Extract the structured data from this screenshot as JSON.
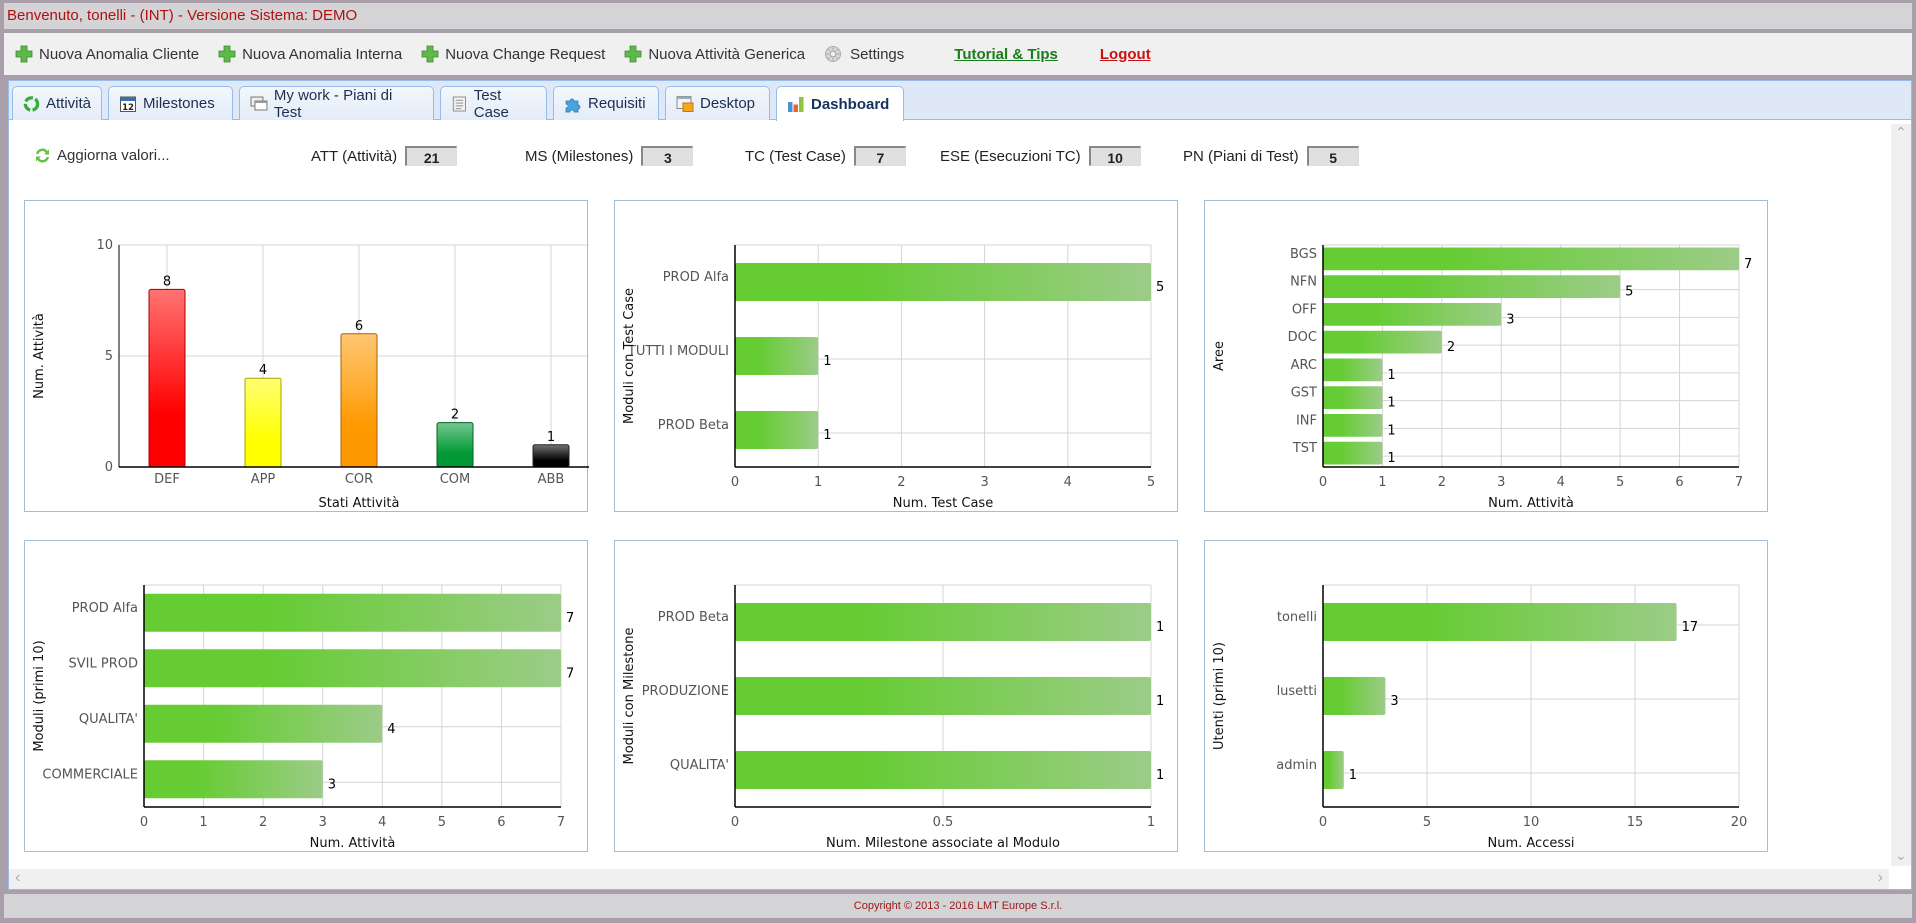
{
  "topbar": {
    "welcome": "Benvenuto, tonelli - (INT) - Versione Sistema: DEMO"
  },
  "toolbar": {
    "items": [
      {
        "label": "Nuova Anomalia Cliente",
        "icon": "plus-icon"
      },
      {
        "label": "Nuova Anomalia Interna",
        "icon": "plus-icon"
      },
      {
        "label": "Nuova Change Request",
        "icon": "plus-icon"
      },
      {
        "label": "Nuova Attività Generica",
        "icon": "plus-icon"
      },
      {
        "label": "Settings",
        "icon": "gear-icon"
      }
    ],
    "tutorial": "Tutorial & Tips",
    "logout": "Logout"
  },
  "tabs": [
    {
      "label": "Attività",
      "icon": "recycle-icon"
    },
    {
      "label": "Milestones",
      "icon": "calendar-icon"
    },
    {
      "label": "My work - Piani di Test",
      "icon": "windows-icon"
    },
    {
      "label": "Test Case",
      "icon": "list-document-icon"
    },
    {
      "label": "Requisiti",
      "icon": "puzzle-icon"
    },
    {
      "label": "Desktop",
      "icon": "desktop-folder-icon"
    },
    {
      "label": "Dashboard",
      "icon": "bar-chart-icon",
      "active": true
    }
  ],
  "stats": {
    "refresh_label": "Aggiorna valori...",
    "items": [
      {
        "label": "ATT (Attività)",
        "value": "21"
      },
      {
        "label": "MS (Milestones)",
        "value": "3"
      },
      {
        "label": "TC (Test Case)",
        "value": "7"
      },
      {
        "label": "ESE (Esecuzioni TC)",
        "value": "10"
      },
      {
        "label": "PN (Piani di Test)",
        "value": "5"
      }
    ]
  },
  "colors": {
    "bar_green": "#66cc33",
    "bar_green_light": "#99cc88",
    "def": "#ff0000",
    "app": "#ffff00",
    "cor": "#ff9900",
    "com": "#009933",
    "abb": "#000000",
    "title_red": "#b01010"
  },
  "chart_data": [
    {
      "type": "bar",
      "orientation": "vertical",
      "categories": [
        "DEF",
        "APP",
        "COR",
        "COM",
        "ABB"
      ],
      "values": [
        8,
        4,
        6,
        2,
        1
      ],
      "colors": [
        "#ff0000",
        "#ffff00",
        "#ff9900",
        "#009933",
        "#000000"
      ],
      "xlabel": "Stati Attività",
      "ylabel": "Num. Attività",
      "ylim": [
        0,
        10
      ],
      "yticks": [
        0,
        5,
        10
      ],
      "grid": true
    },
    {
      "type": "bar",
      "orientation": "horizontal",
      "categories": [
        "PROD Alfa",
        "TUTTI I MODULI",
        "PROD Beta"
      ],
      "values": [
        5,
        1,
        1
      ],
      "xlabel": "Num. Test Case",
      "ylabel": "Moduli con Test Case",
      "xlim": [
        0,
        5
      ],
      "xticks": [
        0,
        1,
        2,
        3,
        4,
        5
      ],
      "grid": true
    },
    {
      "type": "bar",
      "orientation": "horizontal",
      "categories": [
        "BGS",
        "NFN",
        "OFF",
        "DOC",
        "ARC",
        "GST",
        "INF",
        "TST"
      ],
      "values": [
        7,
        5,
        3,
        2,
        1,
        1,
        1,
        1
      ],
      "xlabel": "Num. Attività",
      "ylabel": "Aree",
      "xlim": [
        0,
        7
      ],
      "xticks": [
        0,
        1,
        2,
        3,
        4,
        5,
        6,
        7
      ],
      "grid": true
    },
    {
      "type": "bar",
      "orientation": "horizontal",
      "categories": [
        "PROD Alfa",
        "SVIL PROD",
        "QUALITA'",
        "COMMERCIALE"
      ],
      "values": [
        7,
        7,
        4,
        3
      ],
      "xlabel": "Num. Attività",
      "ylabel": "Moduli (primi 10)",
      "xlim": [
        0,
        7
      ],
      "xticks": [
        0,
        1,
        2,
        3,
        4,
        5,
        6,
        7
      ],
      "grid": true
    },
    {
      "type": "bar",
      "orientation": "horizontal",
      "categories": [
        "PROD Beta",
        "PRODUZIONE",
        "QUALITA'"
      ],
      "values": [
        1,
        1,
        1
      ],
      "xlabel": "Num. Milestone associate al Modulo",
      "ylabel": "Moduli con Milestone",
      "xlim": [
        0,
        1
      ],
      "xticks": [
        0,
        0.5,
        1
      ],
      "grid": true
    },
    {
      "type": "bar",
      "orientation": "horizontal",
      "categories": [
        "tonelli",
        "lusetti",
        "admin"
      ],
      "values": [
        17,
        3,
        1
      ],
      "xlabel": "Num. Accessi",
      "ylabel": "Utenti (primi 10)",
      "xlim": [
        0,
        20
      ],
      "xticks": [
        0,
        5,
        10,
        15,
        20
      ],
      "grid": true
    }
  ],
  "footer": {
    "copyright": "Copyright © 2013 - 2016 LMT Europe S.r.l."
  }
}
